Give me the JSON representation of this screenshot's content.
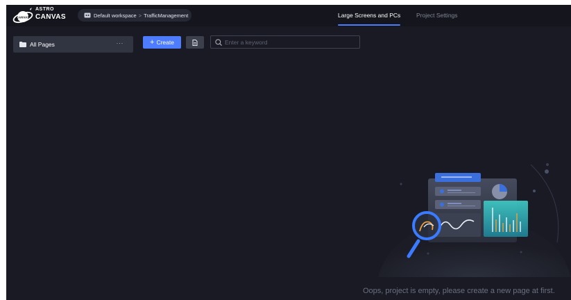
{
  "app": {
    "logo_top": "ASTRO",
    "logo_bottom": "CANVAS",
    "logo_badge": "CANVAS"
  },
  "breadcrumb": {
    "workspace": "Default workspace",
    "separator": ">",
    "project": "TrafficManagement"
  },
  "tabs": [
    {
      "label": "Large Screens and PCs",
      "active": true
    },
    {
      "label": "Project Settings",
      "active": false
    }
  ],
  "sidebar": {
    "items": [
      {
        "label": "All Pages",
        "more": "···"
      }
    ]
  },
  "toolbar": {
    "create_label": "Create",
    "search_placeholder": "Enter a keyword"
  },
  "empty_state": {
    "message": "Oops, project is empty, please create a new page at first."
  },
  "colors": {
    "background": "#191a23",
    "header": "#15161d",
    "accent": "#4d7cff",
    "sidebar_item": "#313441"
  },
  "icons": {
    "workspace": "workspace-icon",
    "folder": "folder-icon",
    "more": "more-icon",
    "import": "import-icon",
    "search": "search-icon"
  }
}
